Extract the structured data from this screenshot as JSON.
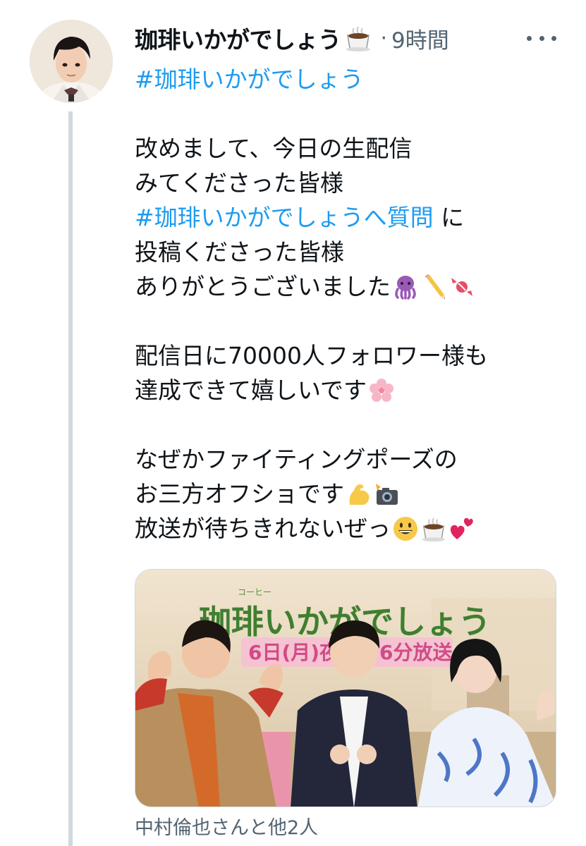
{
  "tweet": {
    "display_name": "珈琲いかがでしょう",
    "name_emoji": "hot-coffee-emoji",
    "separator": "·",
    "time": "9時間",
    "more_label": "more-options",
    "lines": {
      "l1": "#珈琲いかがでしょう",
      "l2": "改めまして、今日の生配信",
      "l3": "みてくださった皆様",
      "l4_tag": "#珈琲いかがでしょうへ質問",
      "l4_rest": " に",
      "l5": "投稿くださった皆様",
      "l6": "ありがとうございました",
      "l7": "配信日に70000人フォロワー様も",
      "l8": "達成できて嬉しいです",
      "l9": "なぜかファイティングポーズの",
      "l10": "お三方オフショです",
      "l11": "放送が待ちきれないぜっ"
    },
    "emojis": {
      "l6": [
        "octopus-emoji",
        "pencil-emoji",
        "candy-emoji"
      ],
      "l8": [
        "cherry-blossom-emoji"
      ],
      "l10": [
        "flexed-biceps-emoji",
        "camera-flash-emoji"
      ],
      "l11": [
        "grinning-face-emoji",
        "hot-coffee-emoji",
        "two-hearts-emoji"
      ]
    },
    "media": {
      "sign_ruby": "コーヒー",
      "sign_title": "珈琲いかがでしょう",
      "sign_date": "6日(月)夜",
      "sign_time": "6分放送"
    },
    "tagged_caption": "中村倫也さんと他2人"
  },
  "colors": {
    "link": "#1d9bf0",
    "secondary_text": "#536471",
    "thread_line": "#cfd9de"
  }
}
